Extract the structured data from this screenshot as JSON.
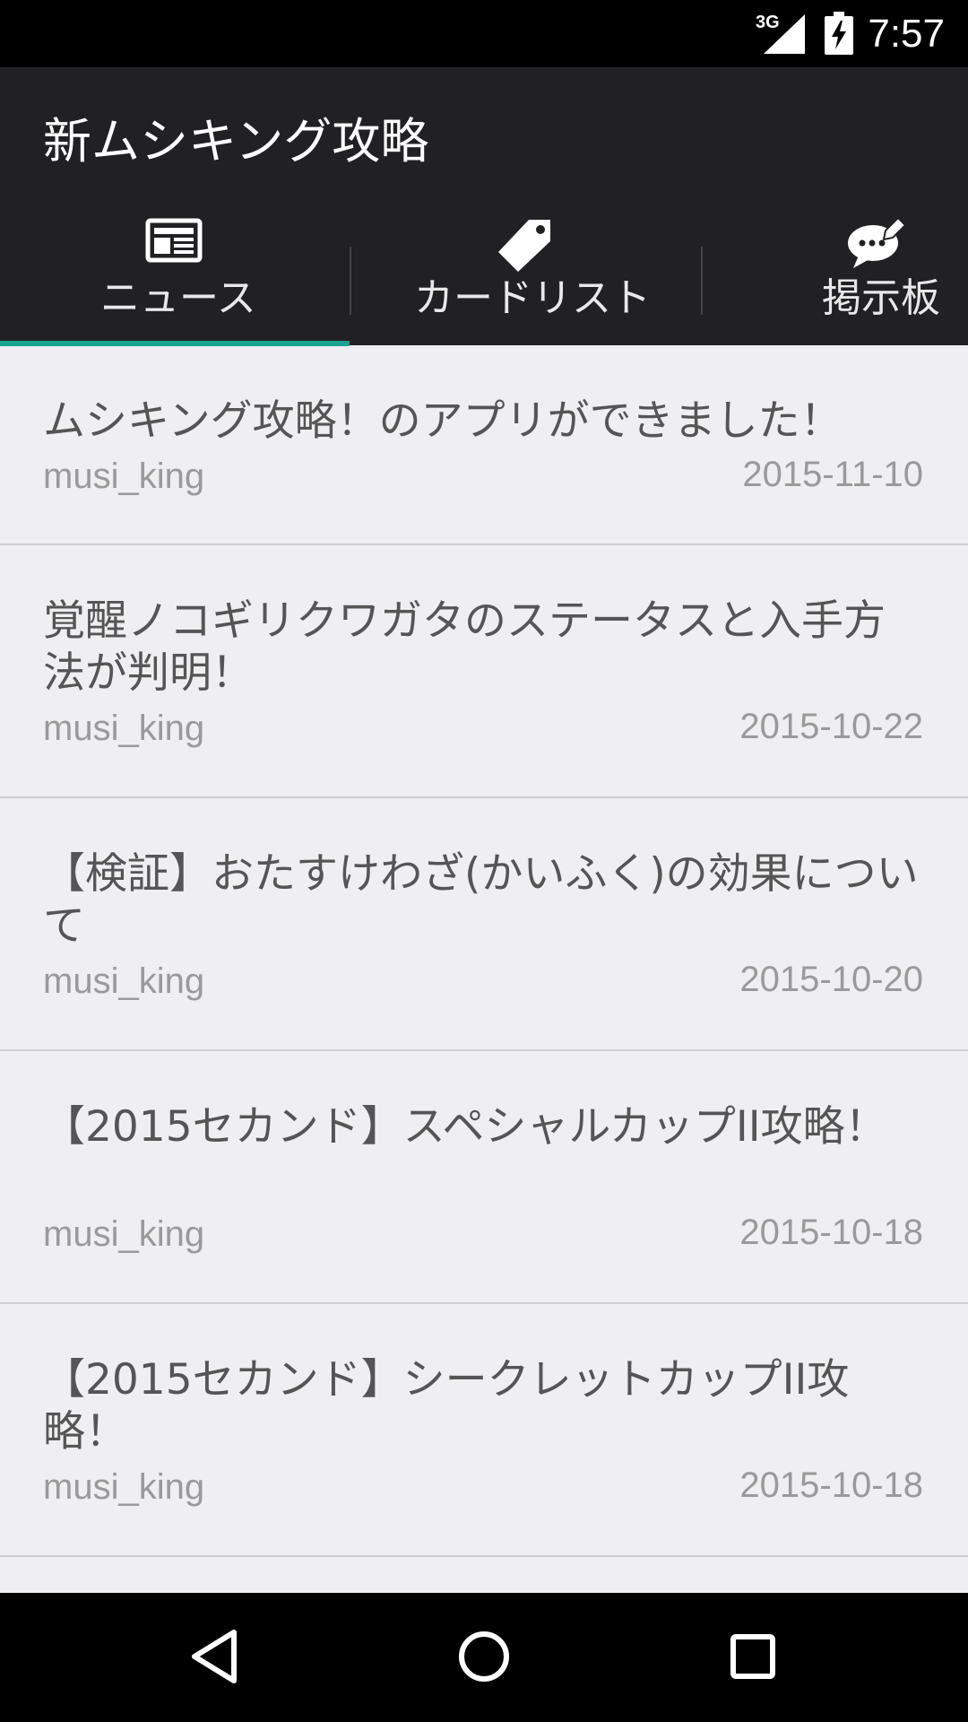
{
  "status_bar": {
    "network": "3G",
    "time": "7:57"
  },
  "app": {
    "title": "新ムシキング攻略"
  },
  "tabs": [
    {
      "label": "ニュース",
      "icon": "newspaper-icon",
      "selected": true
    },
    {
      "label": "カードリスト",
      "icon": "tag-icon",
      "selected": false
    },
    {
      "label": "掲示板",
      "icon": "chat-bubble-icon",
      "selected": false
    }
  ],
  "news": [
    {
      "title": "ムシキング攻略！のアプリができました！",
      "author": "musi_king",
      "date": "2015-11-10"
    },
    {
      "title": "覚醒ノコギリクワガタのステータスと入手方法が判明！",
      "author": "musi_king",
      "date": "2015-10-22"
    },
    {
      "title": "【検証】おたすけわざ(かいふく)の効果について",
      "author": "musi_king",
      "date": "2015-10-20"
    },
    {
      "title": "【2015セカンド】スペシャルカップII攻略！",
      "author": "musi_king",
      "date": "2015-10-18"
    },
    {
      "title": "【2015セカンド】シークレットカップII攻略！",
      "author": "musi_king",
      "date": "2015-10-18"
    }
  ],
  "nav": {
    "back": "back-triangle-icon",
    "home": "home-circle-icon",
    "recents": "recents-square-icon"
  },
  "colors": {
    "app_bar": "#212023",
    "accent": "#1aa391",
    "list_bg": "#efeef0"
  }
}
